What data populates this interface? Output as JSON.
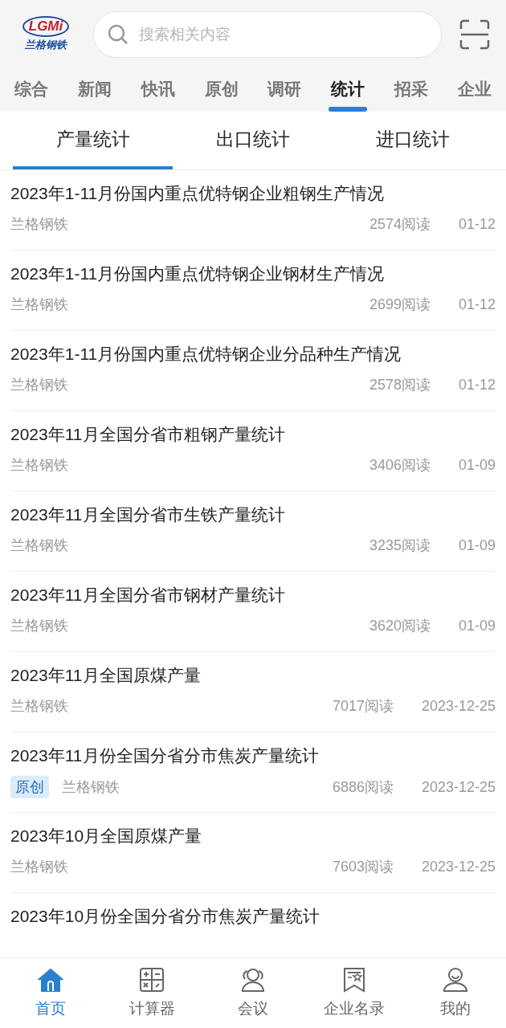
{
  "header": {
    "logo": {
      "mark": "LGMi",
      "name": "兰格钢铁"
    },
    "search": {
      "placeholder": "搜索相关内容"
    }
  },
  "tabs": [
    {
      "label": "综合",
      "selected": false
    },
    {
      "label": "新闻",
      "selected": false
    },
    {
      "label": "快讯",
      "selected": false
    },
    {
      "label": "原创",
      "selected": false
    },
    {
      "label": "调研",
      "selected": false
    },
    {
      "label": "统计",
      "selected": true
    },
    {
      "label": "招采",
      "selected": false
    },
    {
      "label": "企业",
      "selected": false
    }
  ],
  "subtabs": [
    {
      "label": "产量统计",
      "selected": true
    },
    {
      "label": "出口统计",
      "selected": false
    },
    {
      "label": "进口统计",
      "selected": false
    }
  ],
  "articles": [
    {
      "title": "2023年1-11月份国内重点优特钢企业粗钢生产情况",
      "source": "兰格钢铁",
      "reads": "2574阅读",
      "date": "01-12"
    },
    {
      "title": "2023年1-11月份国内重点优特钢企业钢材生产情况",
      "source": "兰格钢铁",
      "reads": "2699阅读",
      "date": "01-12"
    },
    {
      "title": "2023年1-11月份国内重点优特钢企业分品种生产情况",
      "source": "兰格钢铁",
      "reads": "2578阅读",
      "date": "01-12"
    },
    {
      "title": "2023年11月全国分省市粗钢产量统计",
      "source": "兰格钢铁",
      "reads": "3406阅读",
      "date": "01-09"
    },
    {
      "title": "2023年11月全国分省市生铁产量统计",
      "source": "兰格钢铁",
      "reads": "3235阅读",
      "date": "01-09"
    },
    {
      "title": "2023年11月全国分省市钢材产量统计",
      "source": "兰格钢铁",
      "reads": "3620阅读",
      "date": "01-09"
    },
    {
      "title": "2023年11月全国原煤产量",
      "source": "兰格钢铁",
      "reads": "7017阅读",
      "date": "2023-12-25"
    },
    {
      "title": "2023年11月份全国分省分市焦炭产量统计",
      "tag": "原创",
      "source": "兰格钢铁",
      "reads": "6886阅读",
      "date": "2023-12-25"
    },
    {
      "title": "2023年10月全国原煤产量",
      "source": "兰格钢铁",
      "reads": "7603阅读",
      "date": "2023-12-25"
    },
    {
      "title": "2023年10月份全国分省分市焦炭产量统计"
    }
  ],
  "bottom_nav": [
    {
      "label": "首页",
      "kind": "home",
      "selected": true
    },
    {
      "label": "计算器",
      "kind": "calculator",
      "selected": false
    },
    {
      "label": "会议",
      "kind": "people",
      "selected": false
    },
    {
      "label": "企业名录",
      "kind": "ribbon",
      "selected": false
    },
    {
      "label": "我的",
      "kind": "user",
      "selected": false
    }
  ]
}
